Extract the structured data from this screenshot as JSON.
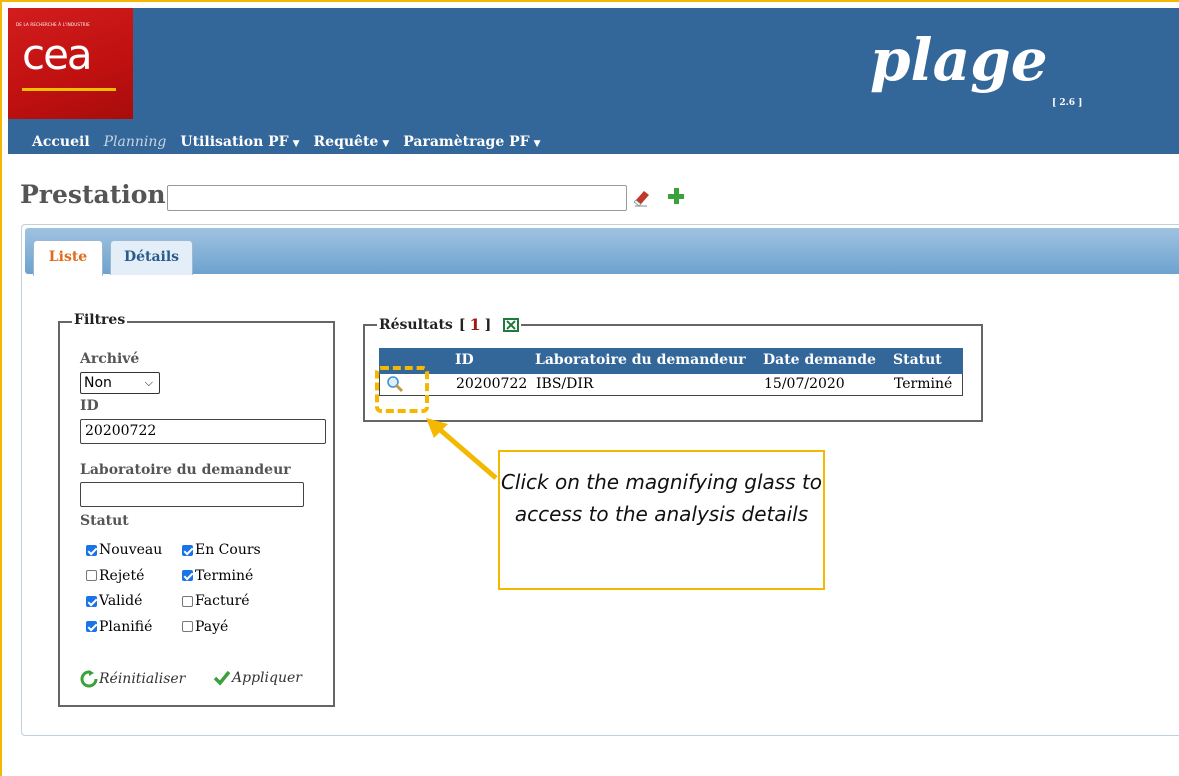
{
  "header": {
    "logo_small_text": "DE LA RECHERCHE À L'INDUSTRIE",
    "logo_text": "cea",
    "app_name": "plage",
    "version": "[ 2.6 ]"
  },
  "nav": {
    "accueil": "Accueil",
    "planning": "Planning",
    "utilisation": "Utilisation PF",
    "requete": "Requête",
    "parametrage": "Paramètrage PF",
    "caret": "▼"
  },
  "page": {
    "title": "Prestation",
    "search_value": ""
  },
  "tabs": {
    "liste": "Liste",
    "details": "Détails"
  },
  "filters": {
    "legend": "Filtres",
    "archive_label": "Archivé",
    "archive_value": "Non",
    "id_label": "ID",
    "id_value": "20200722",
    "lab_label": "Laboratoire du demandeur",
    "lab_value": "",
    "statut_label": "Statut",
    "statuses": [
      {
        "label": "Nouveau",
        "checked": true
      },
      {
        "label": "En Cours",
        "checked": true
      },
      {
        "label": "Rejeté",
        "checked": false
      },
      {
        "label": "Terminé",
        "checked": true
      },
      {
        "label": "Validé",
        "checked": true
      },
      {
        "label": "Facturé",
        "checked": false
      },
      {
        "label": "Planifié",
        "checked": true
      },
      {
        "label": "Payé",
        "checked": false
      }
    ],
    "reset_label": "Réinitialiser",
    "apply_label": "Appliquer"
  },
  "results": {
    "legend": "Résultats",
    "count": "1",
    "bracket_open": "[",
    "bracket_close": "]",
    "columns": [
      "ID",
      "Laboratoire du demandeur",
      "Date demande",
      "Statut"
    ],
    "rows": [
      {
        "id": "20200722",
        "lab": "IBS/DIR",
        "date": "15/07/2020",
        "statut": "Terminé"
      }
    ]
  },
  "annotation": {
    "text": "Click on the magnifying glass to access to the analysis details",
    "color": "#f5b800"
  },
  "colors": {
    "header_bg": "#336699",
    "logo_red": "#c01010",
    "active_tab": "#e06b1c"
  }
}
